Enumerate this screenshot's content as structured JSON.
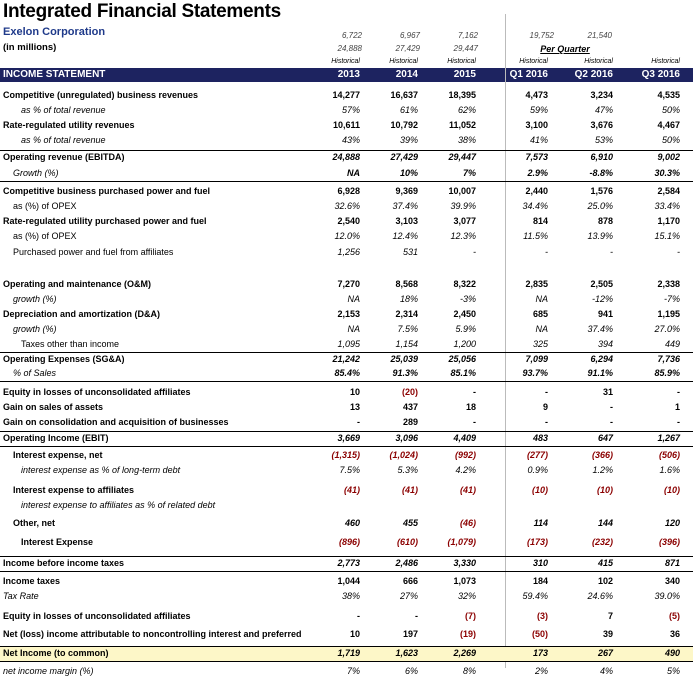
{
  "header": {
    "title": "Integrated Financial Statements",
    "company": "Exelon Corporation",
    "units": "(in millions)",
    "top_numbers": [
      "6,722",
      "6,967",
      "7,162",
      "19,752",
      "21,540"
    ],
    "top_numbers2": [
      "24,888",
      "27,429",
      "29,447"
    ],
    "per_quarter": "Per Quarter",
    "historical_label": "Historical",
    "section": "INCOME STATEMENT",
    "columns": [
      "2013",
      "2014",
      "2015",
      "Q1 2016",
      "Q2 2016",
      "Q3 2016"
    ]
  },
  "rows": [
    {
      "label": "Competitive (unregulated) business revenues",
      "v": [
        "14,277",
        "16,637",
        "18,395",
        "4,473",
        "3,234",
        "4,535"
      ],
      "style": "b"
    },
    {
      "label": "as % of total revenue",
      "v": [
        "57%",
        "61%",
        "62%",
        "59%",
        "47%",
        "50%"
      ],
      "style": "i ind2"
    },
    {
      "label": "Rate-regulated utility revenues",
      "v": [
        "10,611",
        "10,792",
        "11,052",
        "3,100",
        "3,676",
        "4,467"
      ],
      "style": "b"
    },
    {
      "label": "as % of total revenue",
      "v": [
        "43%",
        "39%",
        "38%",
        "41%",
        "53%",
        "50%"
      ],
      "style": "i ind2"
    },
    {
      "label": "Operating revenue (EBITDA)",
      "v": [
        "24,888",
        "27,429",
        "29,447",
        "7,573",
        "6,910",
        "9,002"
      ],
      "style": "b topline"
    },
    {
      "label": "Growth (%)",
      "v": [
        "NA",
        "10%",
        "7%",
        "2.9%",
        "-8.8%",
        "30.3%"
      ],
      "style": "i ind1 botline"
    },
    {
      "label": "Competitive business purchased power and fuel",
      "v": [
        "6,928",
        "9,369",
        "10,007",
        "2,440",
        "1,576",
        "2,584"
      ],
      "style": "b"
    },
    {
      "label": "as (%) of OPEX",
      "v": [
        "32.6%",
        "37.4%",
        "39.9%",
        "34.4%",
        "25.0%",
        "33.4%"
      ],
      "style": "ind1"
    },
    {
      "label": "Rate-regulated utility purchased power and fuel",
      "v": [
        "2,540",
        "3,103",
        "3,077",
        "814",
        "878",
        "1,170"
      ],
      "style": "b"
    },
    {
      "label": "as (%) of OPEX",
      "v": [
        "12.0%",
        "12.4%",
        "12.3%",
        "11.5%",
        "13.9%",
        "15.1%"
      ],
      "style": "ind1"
    },
    {
      "label": "Purchased power and fuel from affiliates",
      "v": [
        "1,256",
        "531",
        "-",
        "-",
        "-",
        "-"
      ],
      "style": "ind1"
    },
    {
      "label": "",
      "v": [
        "",
        "",
        "",
        "",
        "",
        ""
      ],
      "style": ""
    },
    {
      "label": "Operating and maintenance (O&M)",
      "v": [
        "7,270",
        "8,568",
        "8,322",
        "2,835",
        "2,505",
        "2,338"
      ],
      "style": "b"
    },
    {
      "label": "growth (%)",
      "v": [
        "NA",
        "18%",
        "-3%",
        "NA",
        "-12%",
        "-7%"
      ],
      "style": "i ind1"
    },
    {
      "label": "Depreciation and amortization (D&A)",
      "v": [
        "2,153",
        "2,314",
        "2,450",
        "685",
        "941",
        "1,195"
      ],
      "style": "b"
    },
    {
      "label": "growth (%)",
      "v": [
        "NA",
        "7.5%",
        "5.9%",
        "NA",
        "37.4%",
        "27.0%"
      ],
      "style": "i ind1"
    },
    {
      "label": "Taxes other than income",
      "v": [
        "1,095",
        "1,154",
        "1,200",
        "325",
        "394",
        "449"
      ],
      "style": "ind2"
    },
    {
      "label": "Operating Expenses (SG&A)",
      "v": [
        "21,242",
        "25,039",
        "25,056",
        "7,099",
        "6,294",
        "7,736"
      ],
      "style": "b topline"
    },
    {
      "label": "% of Sales",
      "v": [
        "85.4%",
        "91.3%",
        "85.1%",
        "93.7%",
        "91.1%",
        "85.9%"
      ],
      "style": "i ind1 botline"
    },
    {
      "label": "Equity in losses of unconsolidated affiliates",
      "v": [
        "10",
        "(20)",
        "-",
        "-",
        "31",
        "-"
      ],
      "style": "b",
      "red": [
        1
      ]
    },
    {
      "label": "Gain on sales of assets",
      "v": [
        "13",
        "437",
        "18",
        "9",
        "-",
        "1"
      ],
      "style": "b"
    },
    {
      "label": "Gain on consolidation and acquisition of businesses",
      "v": [
        "-",
        "289",
        "-",
        "-",
        "-",
        "-"
      ],
      "style": "b"
    },
    {
      "label": "Operating Income (EBIT)",
      "v": [
        "3,669",
        "3,096",
        "4,409",
        "483",
        "647",
        "1,267"
      ],
      "style": "b topline botline"
    },
    {
      "label": "Interest expense, net",
      "v": [
        "(1,315)",
        "(1,024)",
        "(992)",
        "(277)",
        "(366)",
        "(506)"
      ],
      "style": "b ind1",
      "red": [
        0,
        1,
        2,
        3,
        4,
        5
      ]
    },
    {
      "label": "interest expense as % of long-term debt",
      "v": [
        "7.5%",
        "5.3%",
        "4.2%",
        "0.9%",
        "1.2%",
        "1.6%"
      ],
      "style": "i ind2"
    },
    {
      "label": "Interest expense to affiliates",
      "v": [
        "(41)",
        "(41)",
        "(41)",
        "(10)",
        "(10)",
        "(10)"
      ],
      "style": "b ind1",
      "red": [
        0,
        1,
        2,
        3,
        4,
        5
      ]
    },
    {
      "label": "interest expense to affiliates as % of related debt",
      "v": [
        "",
        "",
        "",
        "",
        "",
        ""
      ],
      "style": "i ind2"
    },
    {
      "label": "Other, net",
      "v": [
        "460",
        "455",
        "(46)",
        "114",
        "144",
        "120"
      ],
      "style": "b ind1",
      "red": [
        2
      ]
    },
    {
      "label": "Interest Expense",
      "v": [
        "(896)",
        "(610)",
        "(1,079)",
        "(173)",
        "(232)",
        "(396)"
      ],
      "style": "b ind2",
      "red": [
        0,
        1,
        2,
        3,
        4,
        5
      ]
    },
    {
      "label": "Income before income taxes",
      "v": [
        "2,773",
        "2,486",
        "3,330",
        "310",
        "415",
        "871"
      ],
      "style": "b topline botline"
    },
    {
      "label": "Income taxes",
      "v": [
        "1,044",
        "666",
        "1,073",
        "184",
        "102",
        "340"
      ],
      "style": "b"
    },
    {
      "label": "Tax Rate",
      "v": [
        "38%",
        "27%",
        "32%",
        "59.4%",
        "24.6%",
        "39.0%"
      ],
      "style": "i"
    },
    {
      "label": "Equity in losses of unconsolidated affiliates",
      "v": [
        "-",
        "-",
        "(7)",
        "(3)",
        "7",
        "(5)"
      ],
      "style": "b",
      "red": [
        2,
        3,
        5
      ]
    },
    {
      "label": "Net (loss) income attributable to noncontrolling interest and preferred",
      "v": [
        "10",
        "197",
        "(19)",
        "(50)",
        "39",
        "36"
      ],
      "style": "b",
      "red": [
        2,
        3
      ]
    },
    {
      "label": "Net Income (to common)",
      "v": [
        "1,719",
        "1,623",
        "2,269",
        "173",
        "267",
        "490"
      ],
      "style": "b topline botline hl"
    },
    {
      "label": "net income margin (%)",
      "v": [
        "7%",
        "6%",
        "8%",
        "2%",
        "4%",
        "5%"
      ],
      "style": "i"
    }
  ]
}
